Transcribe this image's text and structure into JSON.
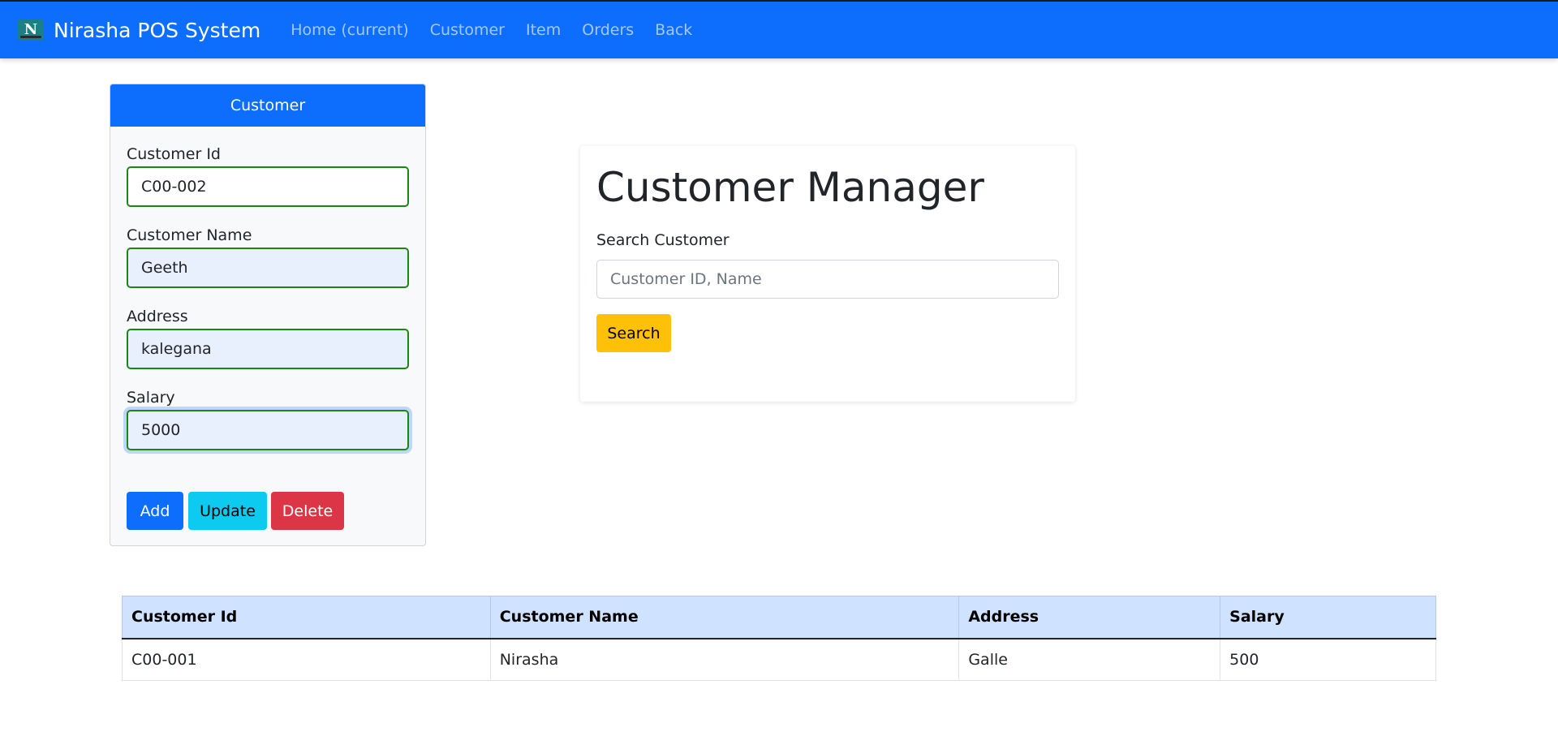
{
  "navbar": {
    "logo_letter": "N",
    "brand": "Nirasha POS System",
    "links": [
      "Home (current)",
      "Customer",
      "Item",
      "Orders",
      "Back"
    ],
    "bg_color": "#0d6efd"
  },
  "customer_form": {
    "header": "Customer",
    "fields": [
      {
        "label": "Customer Id",
        "value": "C00-002"
      },
      {
        "label": "Customer Name",
        "value": "Geeth"
      },
      {
        "label": "Address",
        "value": "kalegana"
      },
      {
        "label": "Salary",
        "value": "5000"
      }
    ],
    "buttons": {
      "add": "Add",
      "update": "Update",
      "delete": "Delete"
    }
  },
  "manager": {
    "title": "Customer Manager",
    "search_label": "Search Customer",
    "search_placeholder": "Customer ID, Name",
    "search_button": "Search"
  },
  "table": {
    "headers": [
      "Customer Id",
      "Customer Name",
      "Address",
      "Salary"
    ],
    "rows": [
      [
        "C00-001",
        "Nirasha",
        "Galle",
        "500"
      ]
    ]
  },
  "colors": {
    "primary": "#0d6efd",
    "info": "#0dcaf0",
    "danger": "#dc3545",
    "warning": "#ffc107",
    "valid_border": "#198711"
  }
}
